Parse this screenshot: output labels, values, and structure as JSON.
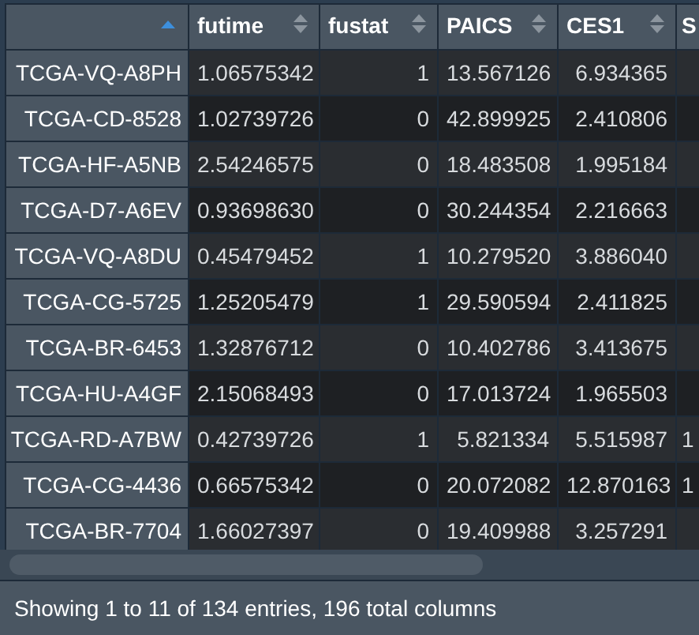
{
  "table": {
    "columns": [
      {
        "sorted": true
      },
      {
        "label": "futime",
        "sorted": false
      },
      {
        "label": "fustat",
        "sorted": false
      },
      {
        "label": "PAICS",
        "sorted": false
      },
      {
        "label": "CES1",
        "sorted": false
      },
      {
        "label": "S"
      }
    ],
    "rows": [
      {
        "cells": [
          "TCGA-VQ-A8PH",
          "1.06575342",
          "1",
          "13.567126",
          "6.934365"
        ]
      },
      {
        "cells": [
          "TCGA-CD-8528",
          "1.02739726",
          "0",
          "42.899925",
          "2.410806"
        ]
      },
      {
        "cells": [
          "TCGA-HF-A5NB",
          "2.54246575",
          "0",
          "18.483508",
          "1.995184"
        ]
      },
      {
        "cells": [
          "TCGA-D7-A6EV",
          "0.93698630",
          "0",
          "30.244354",
          "2.216663"
        ]
      },
      {
        "cells": [
          "TCGA-VQ-A8DU",
          "0.45479452",
          "1",
          "10.279520",
          "3.886040"
        ]
      },
      {
        "cells": [
          "TCGA-CG-5725",
          "1.25205479",
          "1",
          "29.590594",
          "2.411825"
        ]
      },
      {
        "cells": [
          "TCGA-BR-6453",
          "1.32876712",
          "0",
          "10.402786",
          "3.413675"
        ]
      },
      {
        "cells": [
          "TCGA-HU-A4GF",
          "2.15068493",
          "0",
          "17.013724",
          "1.965503"
        ]
      },
      {
        "cells": [
          "TCGA-RD-A7BW",
          "0.42739726",
          "1",
          "5.821334",
          "5.515987",
          "1"
        ]
      },
      {
        "cells": [
          "TCGA-CG-4436",
          "0.66575342",
          "0",
          "20.072082",
          "12.870163",
          "1"
        ]
      },
      {
        "cells": [
          "TCGA-BR-7704",
          "1.66027397",
          "0",
          "19.409988",
          "3.257291"
        ]
      }
    ]
  },
  "footer": {
    "info": "Showing 1 to 11 of 134 entries, 196 total columns"
  }
}
